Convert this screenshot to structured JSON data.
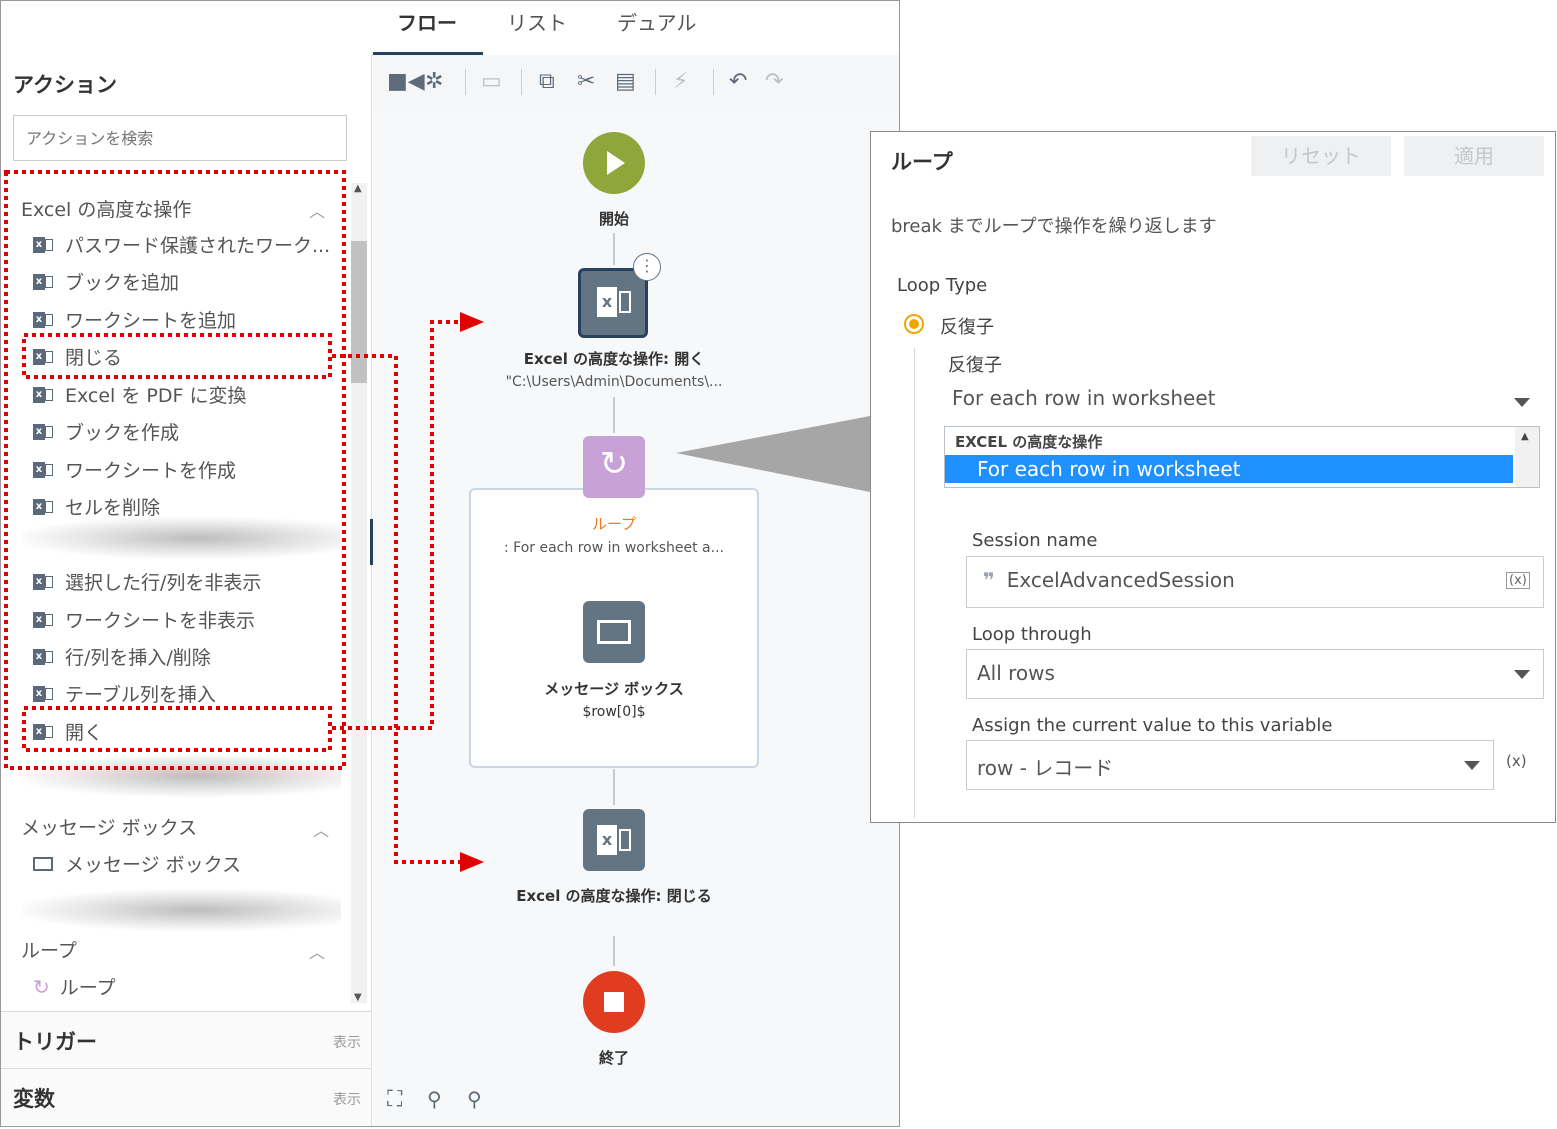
{
  "tabs": [
    "フロー",
    "リスト",
    "デュアル"
  ],
  "actions_panel": {
    "title": "アクション",
    "search_placeholder": "アクションを検索",
    "excel_group": {
      "title": "Excel の高度な操作",
      "items_top": [
        "パスワード保護されたワーク...",
        "ブックを追加",
        "ワークシートを追加",
        "閉じる",
        "Excel を PDF に変換",
        "ブックを作成",
        "ワークシートを作成",
        "セルを削除"
      ],
      "items_bottom": [
        "選択した行/列を非表示",
        "ワークシートを非表示",
        "行/列を挿入/削除",
        "テーブル列を挿入",
        "開く"
      ]
    },
    "msg_group": {
      "title": "メッセージ ボックス",
      "item": "メッセージ ボックス"
    },
    "loop_group": {
      "title": "ループ",
      "item": "ループ"
    },
    "trigger": {
      "title": "トリガー",
      "link": "表示"
    },
    "variables": {
      "title": "変数",
      "link": "表示"
    }
  },
  "flow": {
    "start_label": "開始",
    "open_label": "Excel の高度な操作: 開く",
    "open_sub": "\"C:\\Users\\Admin\\Documents\\...",
    "loop_label": "ループ",
    "loop_sub": ": For each row in worksheet a...",
    "msg_label": "メッセージ ボックス",
    "msg_sub": "$row[0]$",
    "close_label": "Excel の高度な操作: 閉じる",
    "end_label": "終了",
    "colors": {
      "start": "#8ea63a",
      "end": "#e03c1f",
      "loop": "#c8a2d6",
      "loop_text": "#f07b1f",
      "action": "#637483"
    }
  },
  "loop_panel": {
    "title": "ループ",
    "reset_label": "リセット",
    "apply_label": "適用",
    "description": "break までループで操作を繰り返します",
    "loop_type_label": "Loop Type",
    "radio_label": "反復子",
    "iterator_label": "反復子",
    "iterator_value": "For each row in worksheet",
    "dropdown_group": "EXCEL の高度な操作",
    "dropdown_selected": "For each row in worksheet",
    "session_label": "Session name",
    "session_value": "ExcelAdvancedSession",
    "loop_through_label": "Loop through",
    "loop_through_value": "All rows",
    "assign_label": "Assign the current value to this variable",
    "assign_value": "row - レコード",
    "var_icon": "(x)"
  }
}
